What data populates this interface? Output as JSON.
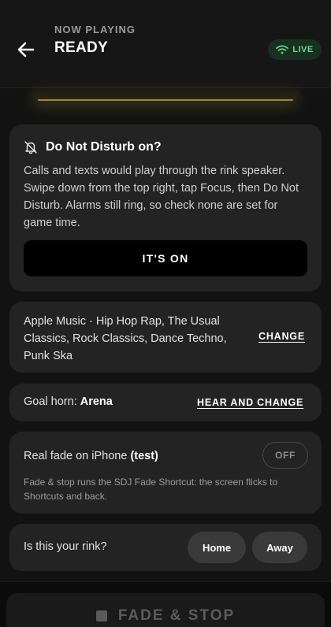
{
  "header": {
    "eyebrow": "NOW PLAYING",
    "title": "READY",
    "live_label": "LIVE",
    "live_color": "#6fd58a"
  },
  "dnd": {
    "icon": "bell-slash-icon",
    "title": "Do Not Disturb on?",
    "body": "Calls and texts would play through the rink speaker. Swipe down from the top right, tap Focus, then Do Not Disturb. Alarms still ring, so check none are set for game time.",
    "button_label": "IT'S ON"
  },
  "music": {
    "text": "Apple Music · Hip Hop Rap, The Usual Classics, Rock Classics, Dance Techno, Punk Ska",
    "change_label": "CHANGE"
  },
  "horn": {
    "label": "Goal horn:",
    "value": "Arena",
    "action_label": "HEAR AND CHANGE"
  },
  "fade": {
    "label": "Real fade on iPhone",
    "test_label": "(test)",
    "toggle_label": "OFF",
    "note": "Fade & stop runs the SDJ Fade Shortcut: the screen flicks to Shortcuts and back."
  },
  "rink": {
    "question": "Is this your rink?",
    "home_label": "Home",
    "away_label": "Away"
  },
  "bottom": {
    "fade_stop_label": "FADE & STOP"
  },
  "colors": {
    "background": "#121212",
    "card": "#232323",
    "accent_glow": "#b99f4a"
  }
}
